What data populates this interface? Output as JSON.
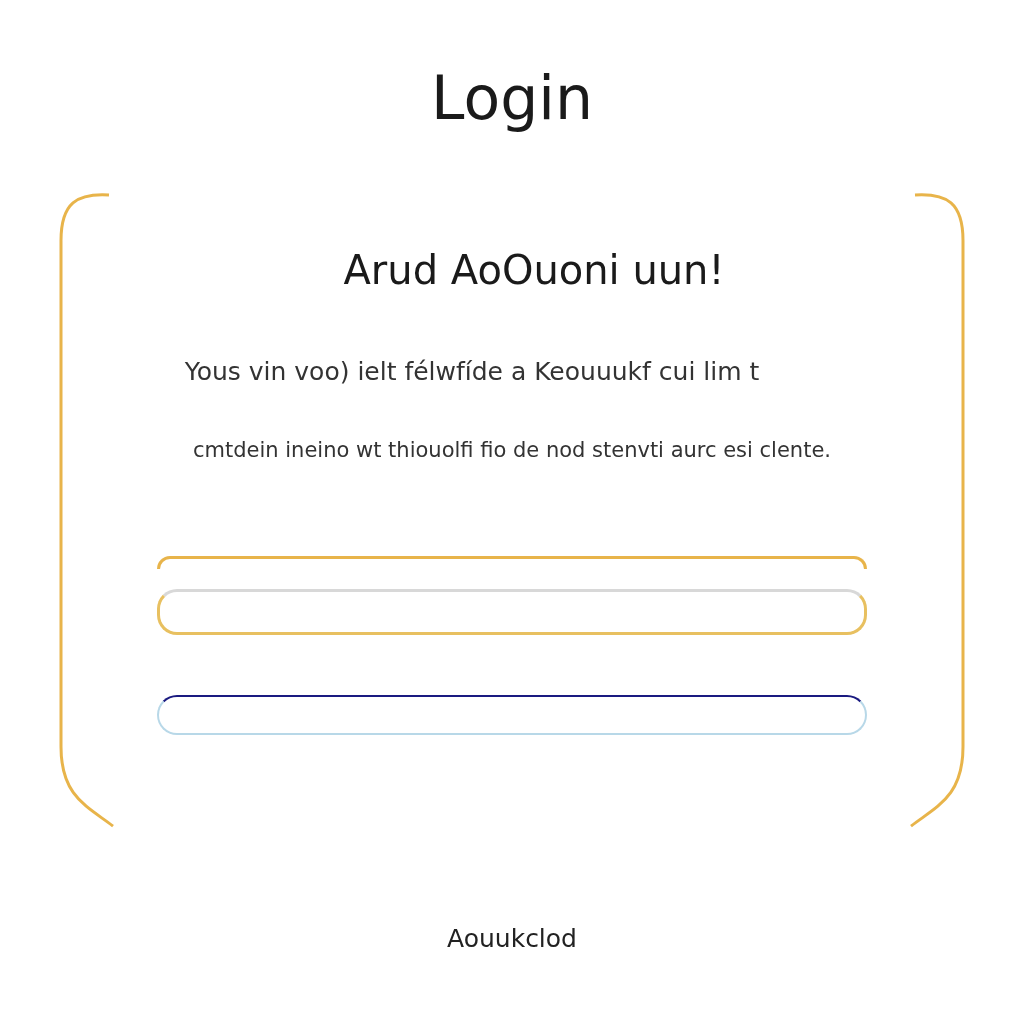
{
  "title": "Login",
  "card": {
    "heading": "Arud AoOuoni uun!",
    "lines": [
      "Yous vin voo) ielt félwfíde a Keouuukf cui lim t",
      "cmtdein ineino wt thiouolfi fio de nod stenvti aurc esi clente."
    ],
    "fields": [
      {
        "kind": "outlined"
      },
      {
        "kind": "accent"
      }
    ]
  },
  "footer_link": "Aouukclod"
}
